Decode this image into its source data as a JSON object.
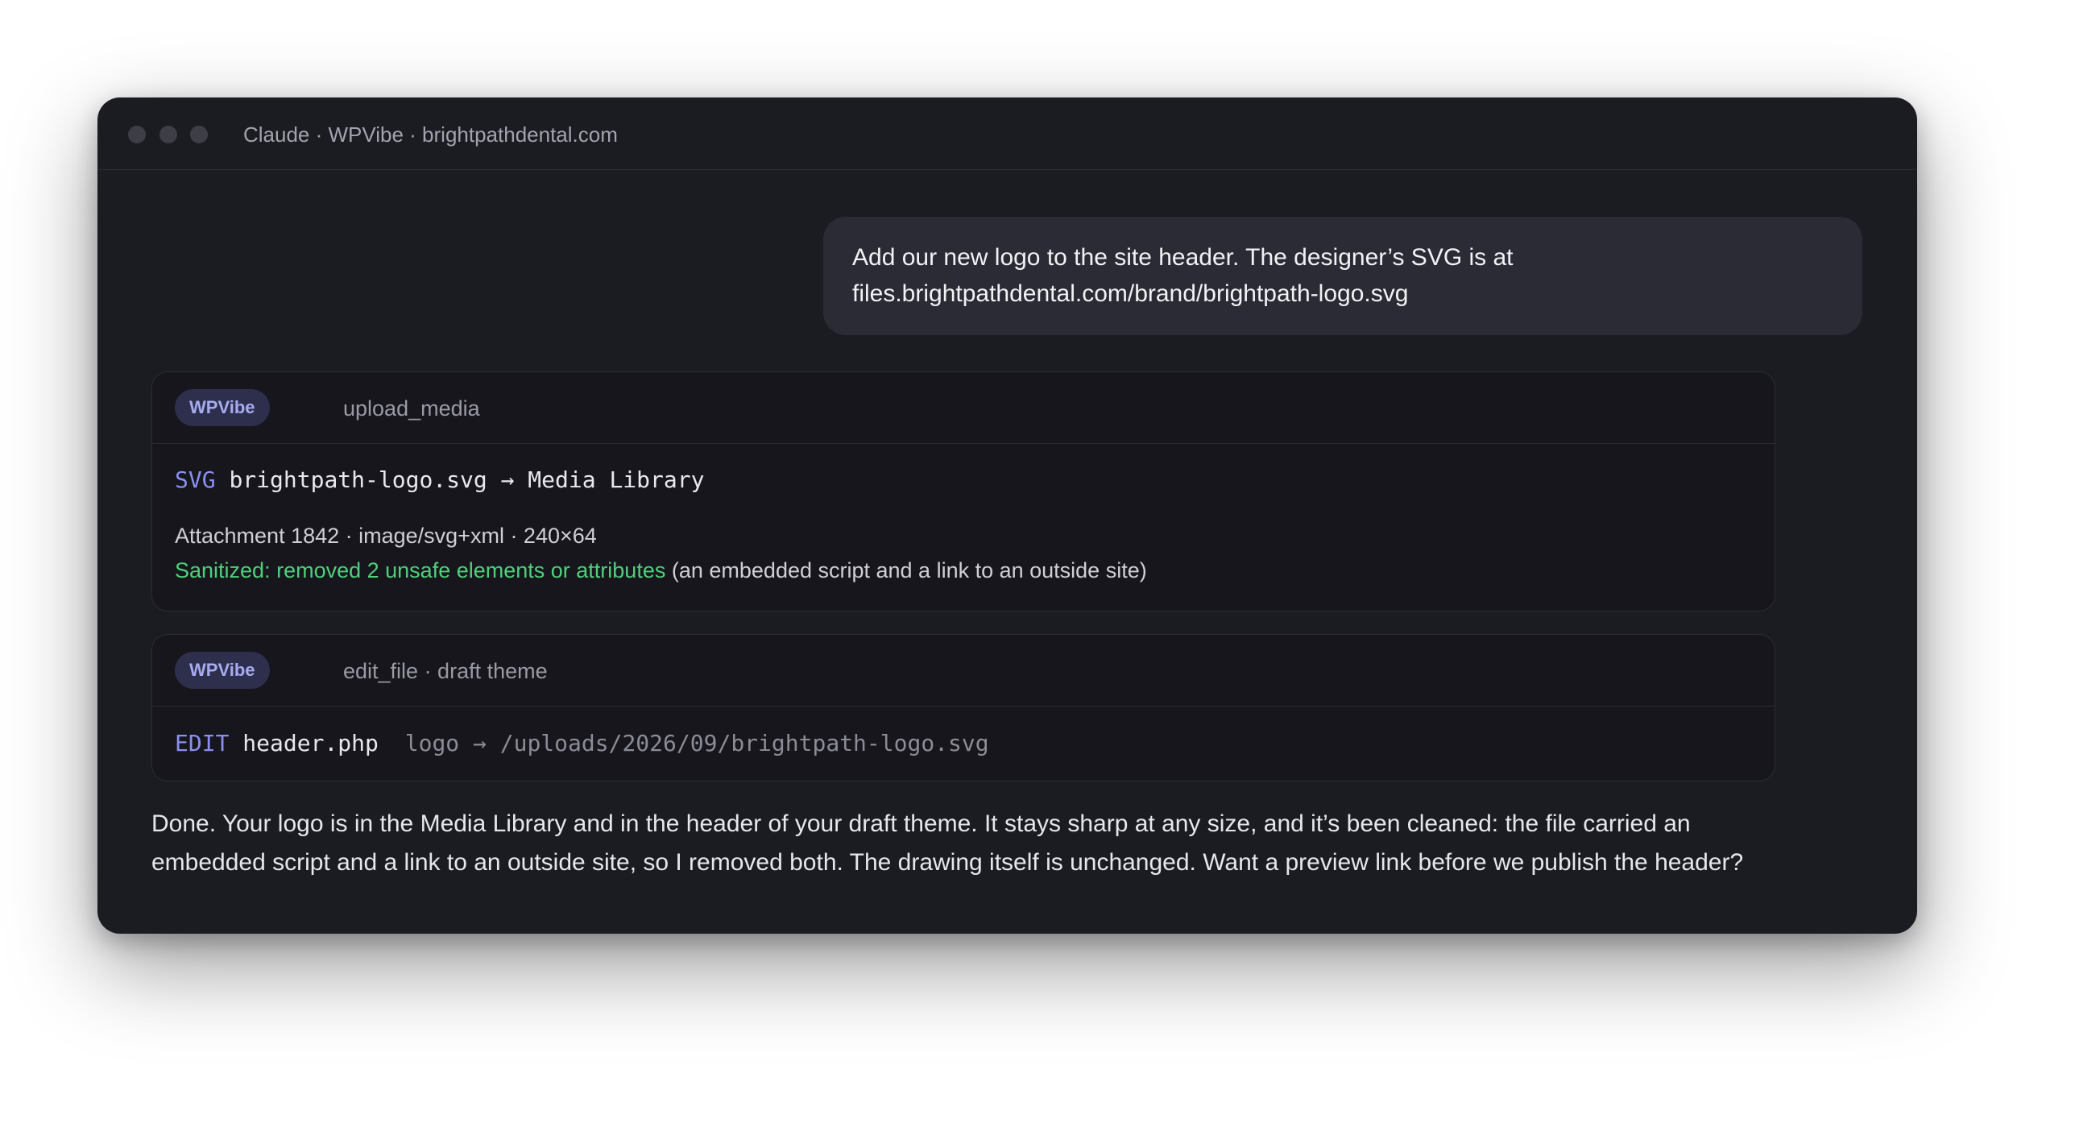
{
  "window": {
    "title": "Claude · WPVibe · brightpathdental.com"
  },
  "user_message": {
    "line1": "Add our new logo to the site header. The designer’s SVG is at",
    "line2": "files.brightpathdental.com/brand/brightpath-logo.svg"
  },
  "tool_calls": [
    {
      "badge": "WPVibe",
      "operation": "upload_media",
      "code_keyword": "SVG",
      "code_main": "brightpath-logo.svg → Media Library",
      "meta": "Attachment 1842 · image/svg+xml · 240×64",
      "sanitized_status": "Sanitized: removed 2 unsafe elements or attributes",
      "sanitized_note": "(an embedded script and a link to an outside site)"
    },
    {
      "badge": "WPVibe",
      "operation": "edit_file · draft theme",
      "code_keyword": "EDIT",
      "code_main": "header.php",
      "code_detail": "logo → /uploads/2026/09/brightpath-logo.svg"
    }
  ],
  "assistant_message": {
    "line1": "Done. Your logo is in the Media Library and in the header of your draft theme. It stays sharp at any size, and it’s been cleaned: the file carried an",
    "line2": "embedded script and a link to an outside site, so I removed both. The drawing itself is unchanged. Want a preview link before we publish the header?"
  },
  "colors": {
    "window_bg": "#1b1b22",
    "user_bubble_bg": "#2b2b35",
    "card_bg": "#16161c",
    "badge_bg": "#2e2f4d",
    "badge_text": "#a7acf0",
    "keyword": "#8a8ff0",
    "success": "#4fd07a"
  }
}
